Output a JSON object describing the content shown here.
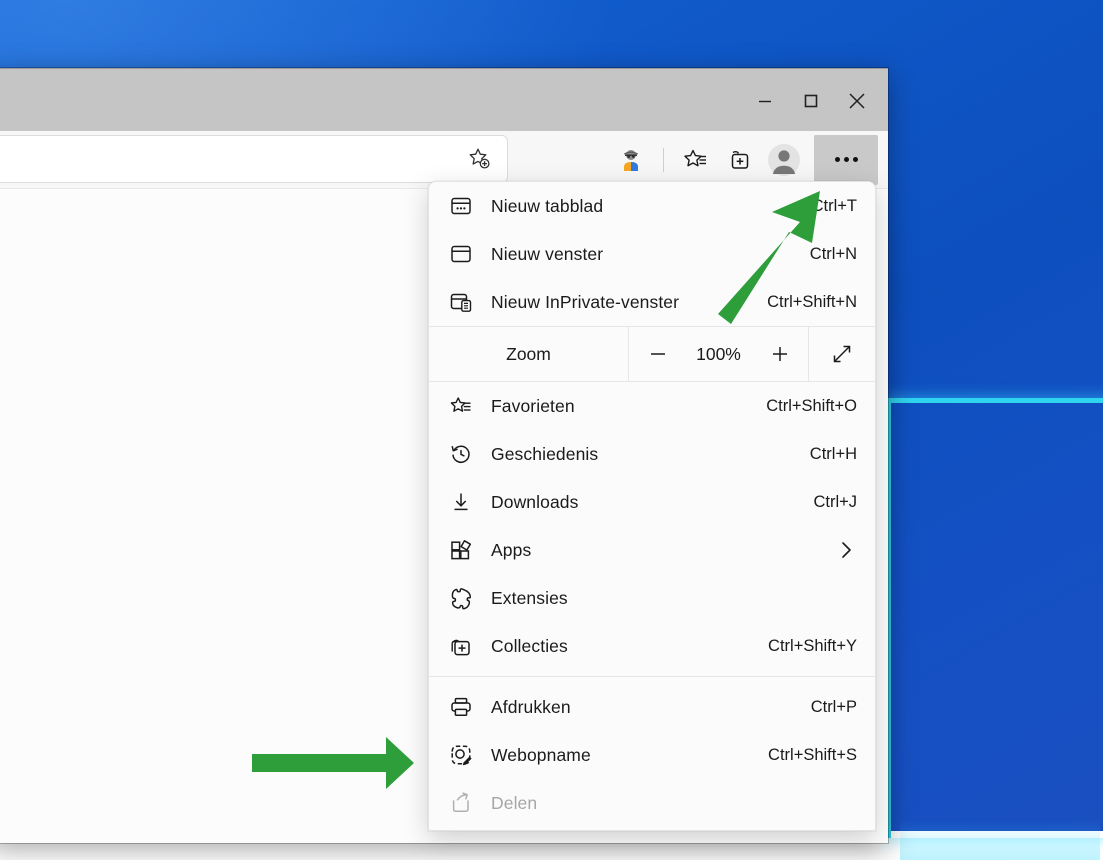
{
  "window": {
    "controls": {
      "minimize": "Minimaliseren",
      "maximize": "Maximaliseren",
      "close": "Sluiten"
    }
  },
  "toolbar": {
    "favorite_add": "Deze pagina toevoegen aan favorieten",
    "collections_icon": "collections-icon",
    "favorites_icon": "favorites-icon",
    "profile_icon": "profile-icon",
    "settings_more_label": "Instellingen en meer"
  },
  "menu": {
    "groups": [
      {
        "items": [
          {
            "icon": "new-tab-icon",
            "label": "Nieuw tabblad",
            "accel": "Ctrl+T",
            "disabled": false,
            "submenu": false
          },
          {
            "icon": "new-window-icon",
            "label": "Nieuw venster",
            "accel": "Ctrl+N",
            "disabled": false,
            "submenu": false
          },
          {
            "icon": "inprivate-window-icon",
            "label": "Nieuw InPrivate-venster",
            "accel": "Ctrl+Shift+N",
            "disabled": false,
            "submenu": false
          }
        ]
      },
      {
        "items": [
          {
            "icon": "favorites-icon",
            "label": "Favorieten",
            "accel": "Ctrl+Shift+O",
            "disabled": false,
            "submenu": false
          },
          {
            "icon": "history-icon",
            "label": "Geschiedenis",
            "accel": "Ctrl+H",
            "disabled": false,
            "submenu": false
          },
          {
            "icon": "downloads-icon",
            "label": "Downloads",
            "accel": "Ctrl+J",
            "disabled": false,
            "submenu": false
          },
          {
            "icon": "apps-icon",
            "label": "Apps",
            "accel": "",
            "disabled": false,
            "submenu": true
          },
          {
            "icon": "extensions-icon",
            "label": "Extensies",
            "accel": "",
            "disabled": false,
            "submenu": false
          },
          {
            "icon": "collections-icon",
            "label": "Collecties",
            "accel": "Ctrl+Shift+Y",
            "disabled": false,
            "submenu": false
          }
        ]
      },
      {
        "items": [
          {
            "icon": "print-icon",
            "label": "Afdrukken",
            "accel": "Ctrl+P",
            "disabled": false,
            "submenu": false
          },
          {
            "icon": "web-capture-icon",
            "label": "Webopname",
            "accel": "Ctrl+Shift+S",
            "disabled": false,
            "submenu": false
          },
          {
            "icon": "share-icon",
            "label": "Delen",
            "accel": "",
            "disabled": true,
            "submenu": false
          }
        ]
      }
    ],
    "zoom": {
      "label": "Zoom",
      "value": "100%",
      "minus_label": "Uitzoomen",
      "plus_label": "Inzoomen",
      "fullscreen_label": "Volledig scherm"
    }
  },
  "annotations": {
    "arrow_color": "#2e9e3a",
    "arrows": [
      {
        "name": "arrow-to-more-button",
        "direction": "up-right"
      },
      {
        "name": "arrow-to-web-capture",
        "direction": "right"
      }
    ]
  },
  "colors": {
    "accent_blue": "#1059c9",
    "window_chrome": "#c5c5c5",
    "menu_bg": "#fbfbfb",
    "wallpaper_cyan": "#2fd4ee"
  }
}
